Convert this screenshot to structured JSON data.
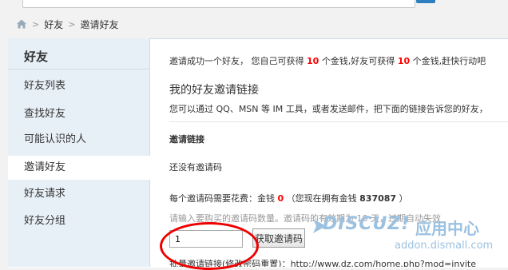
{
  "breadcrumb": {
    "items": [
      "好友",
      "邀请好友"
    ],
    "separator": ">"
  },
  "sidebar": {
    "title": "好友",
    "items": [
      {
        "label": "好友列表"
      },
      {
        "label": "查找好友"
      },
      {
        "label": "可能认识的人"
      },
      {
        "label": "邀请好友",
        "active": true
      },
      {
        "label": "好友请求"
      },
      {
        "label": "好友分组"
      }
    ]
  },
  "main": {
    "intro": {
      "prefix": "邀请成功一个好友， 您自己可获得",
      "self_reward": "10",
      "middle": "个金钱,好友可获得",
      "friend_reward": "10",
      "suffix": "个金钱,赶快行动吧"
    },
    "link_section": {
      "title": "我的好友邀请链接",
      "description": "您可以通过 QQ、MSN 等 IM 工具，或者发送邮件，把下面的链接告诉您的好友，"
    },
    "invite_code": {
      "title": "邀请链接",
      "empty_text": "还没有邀请码",
      "cost_prefix": "每个邀请码需要花费：金钱",
      "cost_value": "0",
      "cost_mid": "（您现在拥有金钱",
      "balance": "837087",
      "cost_suffix": "）",
      "hint": "请输入要购买的邀请码数量。邀请码的有效期为 10 天，过期自动失效",
      "quantity_value": "1",
      "get_button": "获取邀请码"
    },
    "batch_link": "批量邀请链接(修改密码重置)：http://www.dz.com/home.php?mod=invite"
  },
  "watermark": {
    "logo": "DISCUZ!",
    "suffix": "应用中心",
    "url": "addon.dismall.com"
  },
  "colors": {
    "accent": "#2d7fc1",
    "sidebar_bg": "#e8f0f7",
    "highlight_red": "#ff0000",
    "annotation_circle": "#e00000"
  }
}
